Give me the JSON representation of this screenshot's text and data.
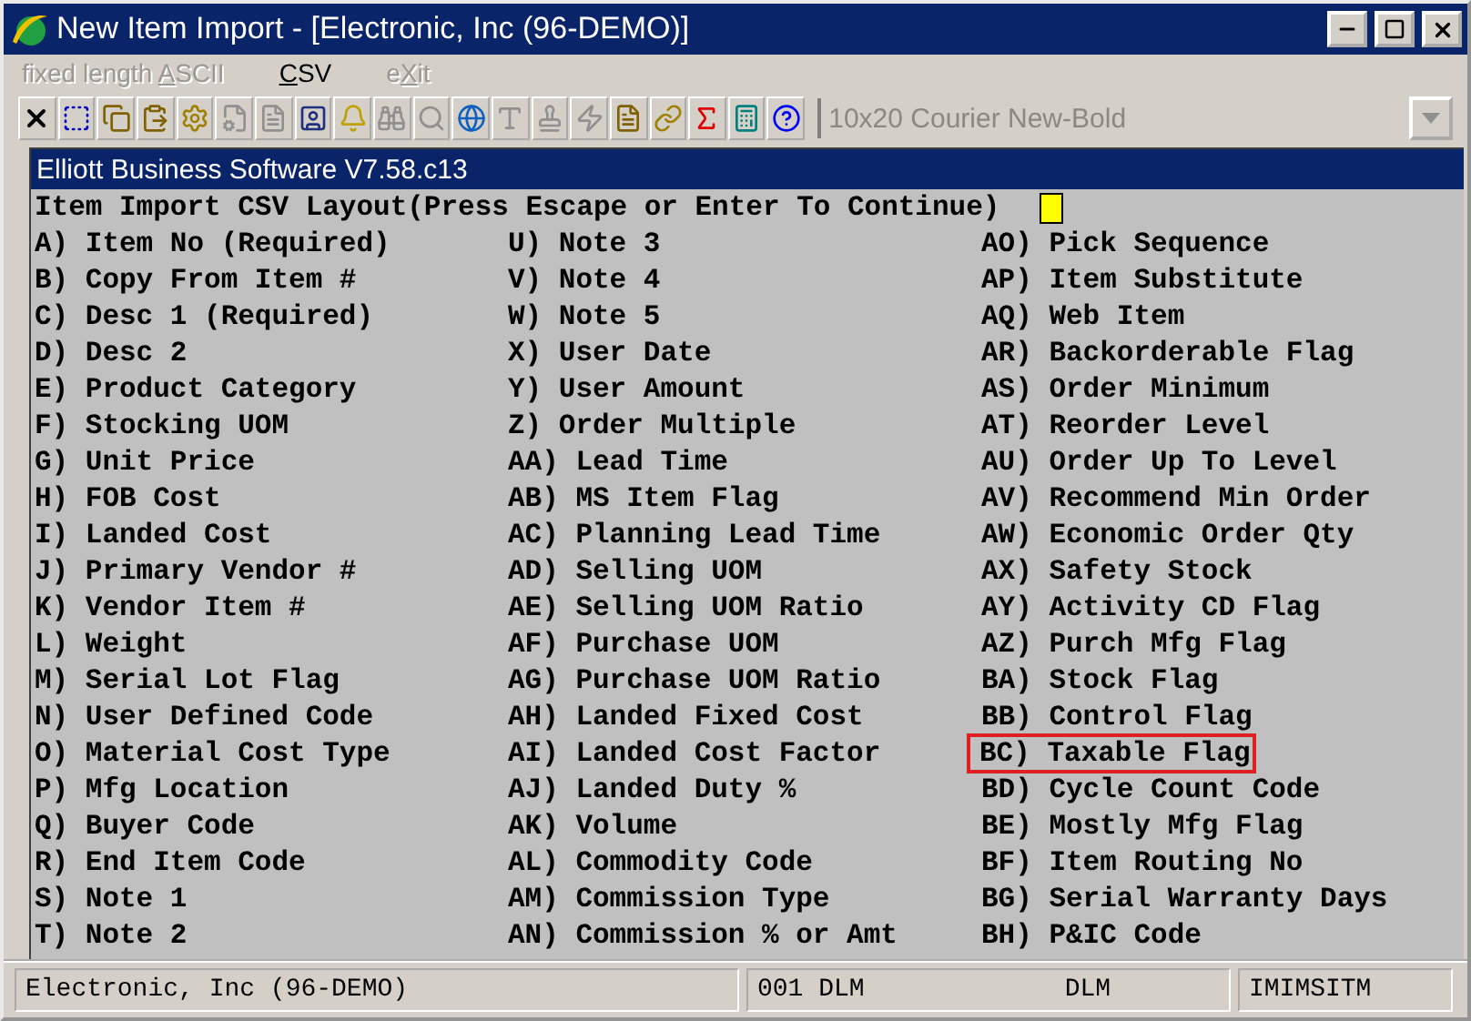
{
  "window": {
    "title": "New Item Import - [Electronic, Inc (96-DEMO)]"
  },
  "menu": [
    {
      "before": "fixed length ",
      "key": "A",
      "after": "SCII",
      "disabled": true
    },
    {
      "key": "C",
      "after": "SV",
      "disabled": false
    },
    {
      "before": "e",
      "key": "X",
      "after": "it",
      "disabled": true
    }
  ],
  "toolbar": [
    {
      "kind": "close",
      "disabled": false
    },
    {
      "kind": "select",
      "disabled": false
    },
    {
      "kind": "copy",
      "disabled": false
    },
    {
      "kind": "paste",
      "disabled": false
    },
    {
      "kind": "gear",
      "disabled": false
    },
    {
      "kind": "properties",
      "disabled": true
    },
    {
      "kind": "list",
      "disabled": true
    },
    {
      "kind": "user",
      "disabled": false
    },
    {
      "kind": "bell",
      "disabled": false
    },
    {
      "kind": "binoculars",
      "disabled": true
    },
    {
      "kind": "search",
      "disabled": true
    },
    {
      "kind": "globe",
      "disabled": false
    },
    {
      "kind": "font",
      "disabled": true
    },
    {
      "kind": "stamp",
      "disabled": true
    },
    {
      "kind": "bolt",
      "disabled": true
    },
    {
      "kind": "boltdoc",
      "disabled": false
    },
    {
      "kind": "link",
      "disabled": false
    },
    {
      "kind": "function",
      "disabled": false
    },
    {
      "kind": "calculator",
      "disabled": false
    },
    {
      "kind": "help",
      "disabled": false
    }
  ],
  "font_select": {
    "value": "10x20 Courier New-Bold",
    "disabled": true
  },
  "inner_window": {
    "title": "Elliott Business Software V7.58.c13"
  },
  "heading": "Item Import CSV Layout(Press Escape or Enter To Continue)",
  "columns": [
    [
      {
        "text": "A) Item No (Required)",
        "selected": false
      },
      {
        "text": "B) Copy From Item #",
        "selected": false
      },
      {
        "text": "C) Desc 1 (Required)",
        "selected": false
      },
      {
        "text": "D) Desc 2",
        "selected": false
      },
      {
        "text": "E) Product Category",
        "selected": false
      },
      {
        "text": "F) Stocking UOM",
        "selected": false
      },
      {
        "text": "G) Unit Price",
        "selected": false
      },
      {
        "text": "H) FOB Cost",
        "selected": false
      },
      {
        "text": "I) Landed Cost",
        "selected": false
      },
      {
        "text": "J) Primary Vendor #",
        "selected": false
      },
      {
        "text": "K) Vendor Item #",
        "selected": false
      },
      {
        "text": "L) Weight",
        "selected": false
      },
      {
        "text": "M) Serial Lot Flag",
        "selected": false
      },
      {
        "text": "N) User Defined Code",
        "selected": false
      },
      {
        "text": "O) Material Cost Type",
        "selected": false
      },
      {
        "text": "P) Mfg Location",
        "selected": false
      },
      {
        "text": "Q) Buyer Code",
        "selected": false
      },
      {
        "text": "R) End Item Code",
        "selected": false
      },
      {
        "text": "S) Note 1",
        "selected": false
      },
      {
        "text": "T) Note 2",
        "selected": false
      }
    ],
    [
      {
        "text": "U) Note 3",
        "selected": false
      },
      {
        "text": "V) Note 4",
        "selected": false
      },
      {
        "text": "W) Note 5",
        "selected": false
      },
      {
        "text": "X) User Date",
        "selected": false
      },
      {
        "text": "Y) User Amount",
        "selected": false
      },
      {
        "text": "Z) Order Multiple",
        "selected": false
      },
      {
        "text": "AA) Lead Time",
        "selected": false
      },
      {
        "text": "AB) MS Item Flag",
        "selected": false
      },
      {
        "text": "AC) Planning Lead Time",
        "selected": false
      },
      {
        "text": "AD) Selling UOM",
        "selected": false
      },
      {
        "text": "AE) Selling UOM Ratio",
        "selected": false
      },
      {
        "text": "AF) Purchase UOM",
        "selected": false
      },
      {
        "text": "AG) Purchase UOM Ratio",
        "selected": false
      },
      {
        "text": "AH) Landed Fixed Cost",
        "selected": false
      },
      {
        "text": "AI) Landed Cost Factor",
        "selected": false
      },
      {
        "text": "AJ) Landed Duty %",
        "selected": false
      },
      {
        "text": "AK) Volume",
        "selected": false
      },
      {
        "text": "AL) Commodity Code",
        "selected": false
      },
      {
        "text": "AM) Commission Type",
        "selected": false
      },
      {
        "text": "AN) Commission % or Amt",
        "selected": false
      }
    ],
    [
      {
        "text": "AO) Pick Sequence",
        "selected": false
      },
      {
        "text": "AP) Item Substitute",
        "selected": false
      },
      {
        "text": "AQ) Web Item",
        "selected": false
      },
      {
        "text": "AR) Backorderable Flag",
        "selected": false
      },
      {
        "text": "AS) Order Minimum",
        "selected": false
      },
      {
        "text": "AT) Reorder Level",
        "selected": false
      },
      {
        "text": "AU) Order Up To Level",
        "selected": false
      },
      {
        "text": "AV) Recommend Min Order",
        "selected": false
      },
      {
        "text": "AW) Economic Order Qty",
        "selected": false
      },
      {
        "text": "AX) Safety Stock",
        "selected": false
      },
      {
        "text": "AY) Activity CD Flag",
        "selected": false
      },
      {
        "text": "AZ) Purch Mfg Flag",
        "selected": false
      },
      {
        "text": "BA) Stock Flag",
        "selected": false
      },
      {
        "text": "BB) Control Flag",
        "selected": false
      },
      {
        "text": "BC) Taxable Flag",
        "selected": true
      },
      {
        "text": "BD) Cycle Count Code",
        "selected": false
      },
      {
        "text": "BE) Mostly Mfg Flag",
        "selected": false
      },
      {
        "text": "BF) Item Routing No",
        "selected": false
      },
      {
        "text": "BG) Serial Warranty Days",
        "selected": false
      },
      {
        "text": "BH) P&IC Code",
        "selected": false
      }
    ]
  ],
  "status_bar": [
    "Electronic, Inc (96-DEMO)",
    "001 DLM",
    "DLM",
    "IMIMSITM"
  ]
}
